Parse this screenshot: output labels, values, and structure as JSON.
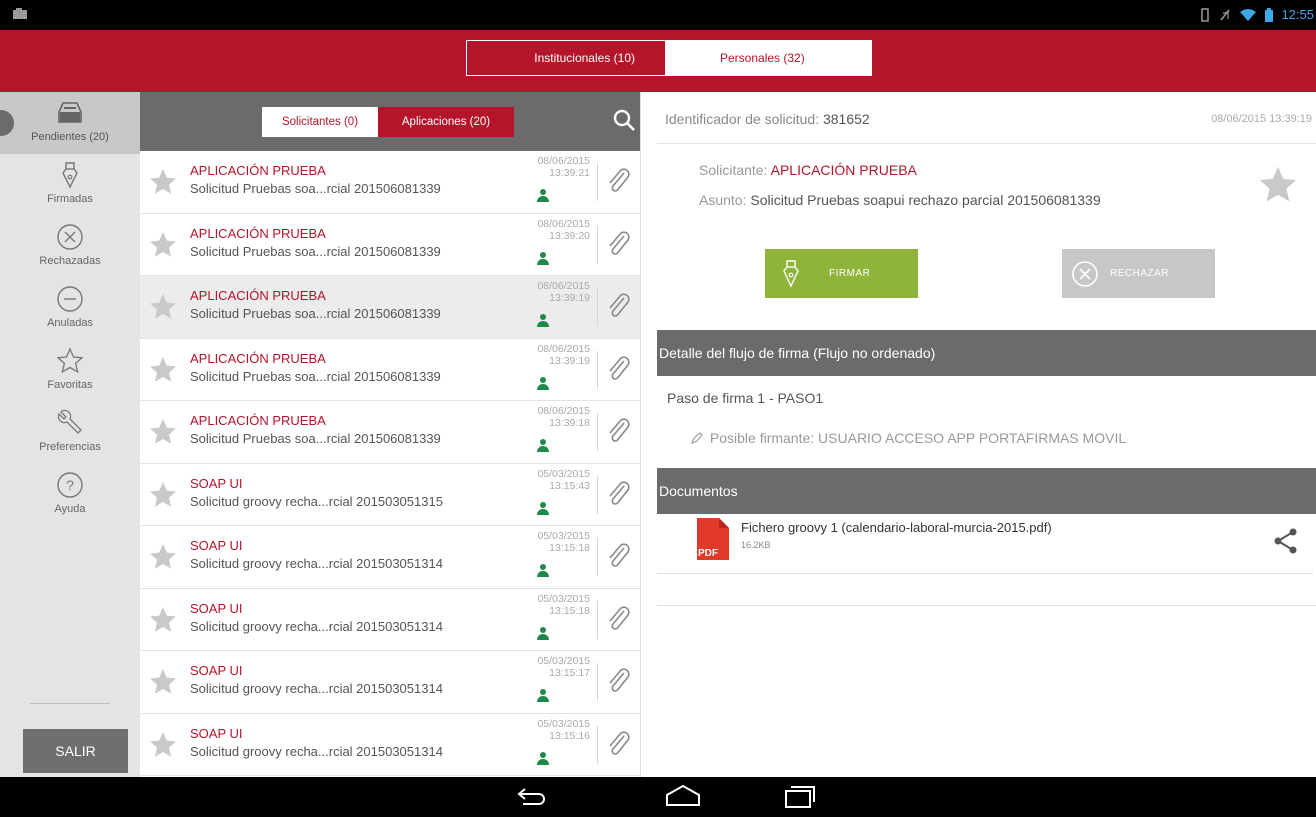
{
  "status_bar": {
    "time": "12:55"
  },
  "top_tabs": [
    {
      "label": "Institucionales (10)"
    },
    {
      "label": "Personales (32)"
    }
  ],
  "sidebar": {
    "items": [
      {
        "label": "Pendientes (20)",
        "icon": "inbox-tray-icon"
      },
      {
        "label": "Firmadas",
        "icon": "pen-nib-icon"
      },
      {
        "label": "Rechazadas",
        "icon": "circle-x-icon"
      },
      {
        "label": "Anuladas",
        "icon": "circle-minus-icon"
      },
      {
        "label": "Favoritas",
        "icon": "star-outline-icon"
      },
      {
        "label": "Preferencias",
        "icon": "wrench-icon"
      },
      {
        "label": "Ayuda",
        "icon": "help-circle-icon"
      }
    ],
    "logout_label": "SALIR"
  },
  "list_header": {
    "solicitantes_label": "Solicitantes (0)",
    "aplicaciones_label": "Aplicaciones (20)"
  },
  "requests": [
    {
      "title": "APLICACIÓN PRUEBA",
      "subject": "Solicitud Pruebas soa...rcial 201506081339",
      "date": "08/06/2015",
      "time": "13:39:21"
    },
    {
      "title": "APLICACIÓN PRUEBA",
      "subject": "Solicitud Pruebas soa...rcial 201506081339",
      "date": "08/06/2015",
      "time": "13:39:20"
    },
    {
      "title": "APLICACIÓN PRUEBA",
      "subject": "Solicitud Pruebas soa...rcial 201506081339",
      "date": "08/06/2015",
      "time": "13:39:19"
    },
    {
      "title": "APLICACIÓN PRUEBA",
      "subject": "Solicitud Pruebas soa...rcial 201506081339",
      "date": "08/06/2015",
      "time": "13:39:19"
    },
    {
      "title": "APLICACIÓN PRUEBA",
      "subject": "Solicitud Pruebas soa...rcial 201506081339",
      "date": "08/06/2015",
      "time": "13:39:18"
    },
    {
      "title": "SOAP UI",
      "subject": "Solicitud groovy recha...rcial 201503051315",
      "date": "05/03/2015",
      "time": "13:15:43"
    },
    {
      "title": "SOAP UI",
      "subject": "Solicitud groovy recha...rcial 201503051314",
      "date": "05/03/2015",
      "time": "13:15:18"
    },
    {
      "title": "SOAP UI",
      "subject": "Solicitud groovy recha...rcial 201503051314",
      "date": "05/03/2015",
      "time": "13:15:18"
    },
    {
      "title": "SOAP UI",
      "subject": "Solicitud groovy recha...rcial 201503051314",
      "date": "05/03/2015",
      "time": "13:15:17"
    },
    {
      "title": "SOAP UI",
      "subject": "Solicitud groovy recha...rcial 201503051314",
      "date": "05/03/2015",
      "time": "13:15:16"
    }
  ],
  "detail": {
    "id_label": "Identificador de solicitud:",
    "id_value": "381652",
    "datetime": "08/06/2015 13:39:19",
    "solicitante_label": "Solicitante:",
    "solicitante_value": "APLICACIÓN PRUEBA",
    "asunto_label": "Asunto:",
    "asunto_value": "Solicitud Pruebas soapui rechazo parcial 201506081339",
    "sign_label": "FIRMAR",
    "reject_label": "RECHAZAR",
    "flow_header": "Detalle del flujo de firma (Flujo no ordenado)",
    "step_label": "Paso de firma 1 - PASO1",
    "signer_text": "Posible firmante: USUARIO ACCESO APP PORTAFIRMAS MOVIL",
    "docs_header": "Documentos",
    "document": {
      "name": "Fichero groovy 1 (calendario-laboral-murcia-2015.pdf)",
      "size": "16.2KB",
      "type_badge": "PDF"
    }
  },
  "colors": {
    "brand_red": "#b4152b",
    "sign_green": "#8fb43a",
    "header_gray": "#6b6b6b",
    "user_green": "#1e8a4a"
  }
}
